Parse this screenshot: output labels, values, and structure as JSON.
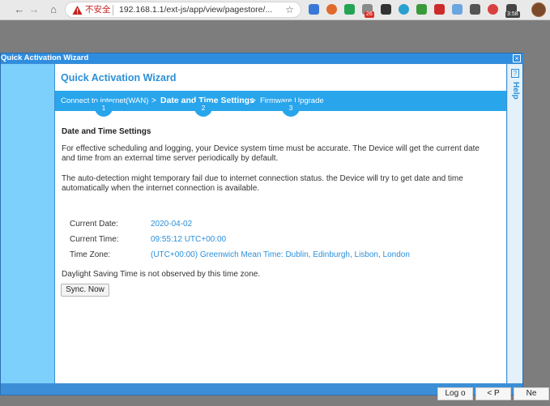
{
  "browser": {
    "nav_back": "←",
    "nav_forward": "→",
    "nav_reload": "C",
    "nav_home": "⌂",
    "security_label": "不安全",
    "url": "192.168.1.1/ext-js/app/view/pagestore/...",
    "star": "☆",
    "badge_mail": "26",
    "badge_time": "3:58"
  },
  "dialog": {
    "title": "Quick Activation Wizard",
    "close_label": "×",
    "help_icon": "?",
    "help_label": "Help"
  },
  "wizard": {
    "title": "Quick Activation Wizard",
    "steps": [
      {
        "label": "Connect to internet(WAN)",
        "number": "1"
      },
      {
        "label": "Date and Time Settings",
        "number": "2"
      },
      {
        "label": "Firmware Upgrade",
        "number": "3"
      }
    ],
    "step_separator": ">"
  },
  "content": {
    "section_title": "Date and Time Settings",
    "para1": "For effective scheduling and logging, your Device system time must be accurate. The Device will get the current date and time from an external time server periodically by default.",
    "para2": "The auto-detection might temporary fail due to internet connection status. the Device will try to get date and time automatically when the internet connection is available.",
    "current_date_label": "Current Date:",
    "current_date": "2020-04-02",
    "current_time_label": "Current Time:",
    "current_time": "09:55:12 UTC+00:00",
    "time_zone_label": "Time Zone:",
    "time_zone": "(UTC+00:00) Greenwich Mean Time: Dublin, Edinburgh, Lisbon, London",
    "dst_note": "Daylight Saving Time is not observed by this time zone.",
    "sync_button": "Sync. Now"
  },
  "footer": {
    "btn1": "Log o",
    "btn2": "< P",
    "btn3": "Ne"
  },
  "colors": {
    "accent": "#2b90d9",
    "step_bar": "#29a5ec",
    "sidebar": "#7cd0fb"
  }
}
